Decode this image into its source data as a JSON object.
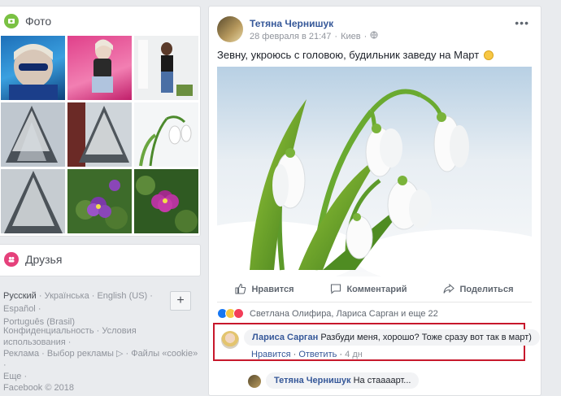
{
  "photos": {
    "title": "Фото",
    "items": [
      {
        "kind": "selfie-blue"
      },
      {
        "kind": "pink-pose"
      },
      {
        "kind": "garden-pose"
      },
      {
        "kind": "snow-tree"
      },
      {
        "kind": "snow-tree-window"
      },
      {
        "kind": "snowdrops"
      },
      {
        "kind": "snow-tree-2"
      },
      {
        "kind": "violets"
      },
      {
        "kind": "violets-2"
      }
    ]
  },
  "friends": {
    "title": "Друзья"
  },
  "languages": {
    "items": [
      "Русский",
      "Українська",
      "English (US)",
      "Español",
      "Português (Brasil)"
    ],
    "plus": "+"
  },
  "footer": {
    "lines": [
      "Конфиденциальность · Условия использования ·",
      "Реклама · Выбор рекламы ▷ · Файлы «cookie» ·",
      "Еще ·",
      "Facebook © 2018"
    ]
  },
  "post": {
    "author": "Тетяна Чернишук",
    "date": "28 февраля в 21:47",
    "location": "Киев",
    "more": "•••",
    "text": "Зевну, укроюсь с головою, будильник заведу на Март",
    "actions": {
      "like": "Нравится",
      "comment": "Комментарий",
      "share": "Поделиться"
    },
    "reactions_text": "Светлана Олифира, Лариса Сарган и еще 22"
  },
  "comment": {
    "author": "Лариса Сарган",
    "text": "Разбуди меня, хорошо? Тоже сразу вот так в март)",
    "like": "Нравится",
    "reply": "Ответить",
    "time": "4 дн"
  },
  "reply": {
    "author": "Тетяна Чернишук",
    "text": "На стааaарт..."
  },
  "colors": {
    "link": "#365899",
    "highlight": "#c7182c",
    "bg": "#e9ebee"
  }
}
